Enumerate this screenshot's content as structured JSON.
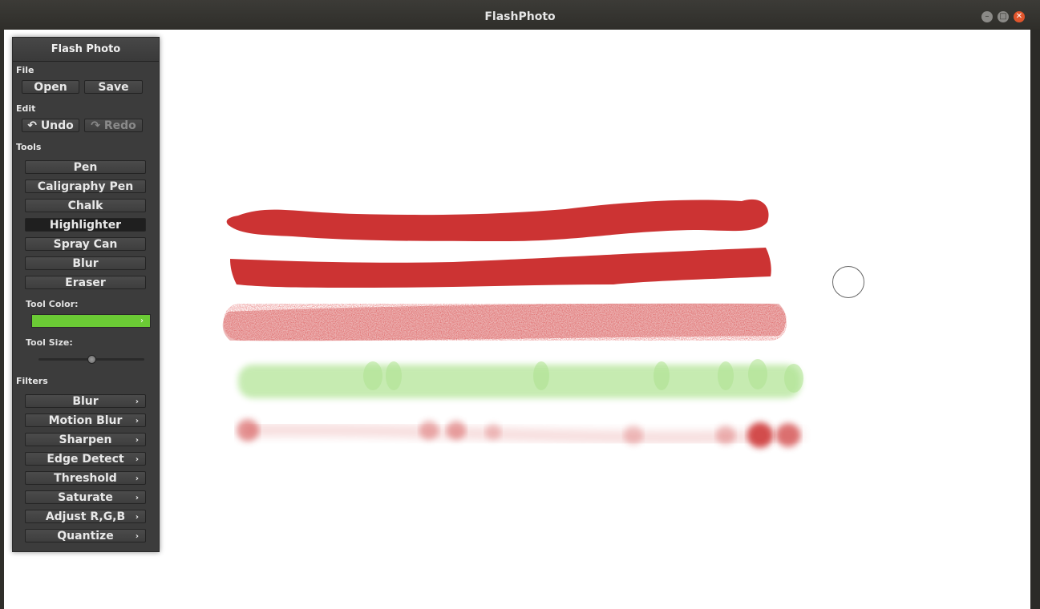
{
  "window": {
    "title": "FlashPhoto"
  },
  "panel": {
    "title": "Flash Photo",
    "file": {
      "label": "File",
      "open": "Open",
      "save": "Save"
    },
    "edit": {
      "label": "Edit",
      "undo": "Undo",
      "redo": "Redo"
    },
    "tools": {
      "label": "Tools",
      "items": [
        "Pen",
        "Caligraphy Pen",
        "Chalk",
        "Highlighter",
        "Spray Can",
        "Blur",
        "Eraser"
      ],
      "selected": "Highlighter",
      "color_label": "Tool Color:",
      "color": "#6bcb35",
      "size_label": "Tool Size:",
      "size_fraction": 0.5
    },
    "filters": {
      "label": "Filters",
      "items": [
        "Blur",
        "Motion Blur",
        "Sharpen",
        "Edge Detect",
        "Threshold",
        "Saturate",
        "Adjust R,G,B",
        "Quantize"
      ]
    }
  },
  "colors": {
    "stroke_red": "#cc3333",
    "highlighter_green": "#6bcb35"
  }
}
